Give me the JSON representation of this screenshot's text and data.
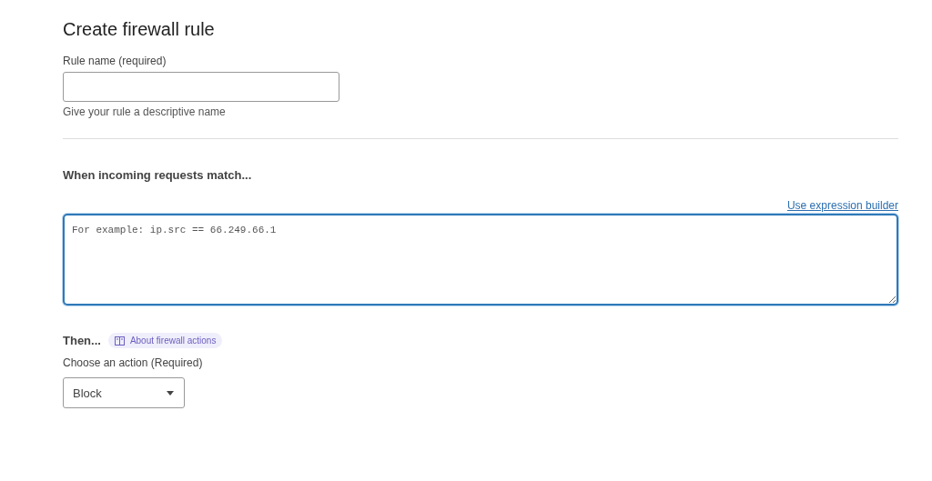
{
  "title": "Create firewall rule",
  "rule_name": {
    "label": "Rule name (required)",
    "hint": "Give your rule a descriptive name"
  },
  "match": {
    "heading": "When incoming requests match...",
    "link": "Use expression builder",
    "placeholder": "For example: ip.src == 66.249.66.1",
    "focused": true
  },
  "action": {
    "heading": "Then...",
    "help_link": "About firewall actions",
    "label": "Choose an action (Required)",
    "value": "Block"
  }
}
